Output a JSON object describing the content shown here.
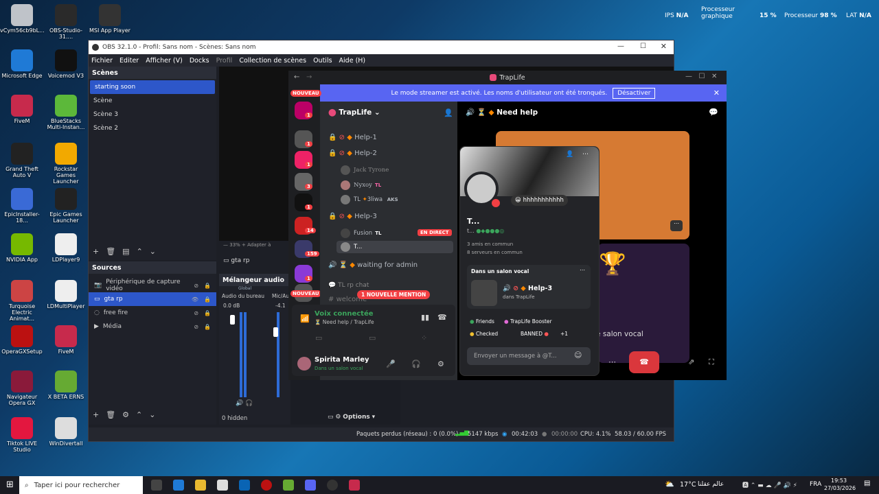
{
  "desktop": {
    "icons": [
      {
        "label": "vCym56cb9bL...",
        "color": "#bfc3c9"
      },
      {
        "label": "OBS-Studio-31....",
        "color": "#2a2a2a"
      },
      {
        "label": "MSI App Player",
        "color": "#333"
      },
      {
        "label": "Microsoft Edge",
        "color": "#1f7ad6"
      },
      {
        "label": "Voicemod V3",
        "color": "#111"
      },
      {
        "label": "FiveM",
        "color": "#c72a4c"
      },
      {
        "label": "BlueStacks Multi-Instan...",
        "color": "#5cb83a"
      },
      {
        "label": "Grand Theft Auto V",
        "color": "#222"
      },
      {
        "label": "Rockstar Games Launcher",
        "color": "#f2a900"
      },
      {
        "label": "EpicInstaller-18...",
        "color": "#3a6ad6"
      },
      {
        "label": "Epic Games Launcher",
        "color": "#222"
      },
      {
        "label": "NVIDIA App",
        "color": "#76b900"
      },
      {
        "label": "LDPlayer9",
        "color": "#eee"
      },
      {
        "label": "Turquoise Electric Animat...",
        "color": "#c44"
      },
      {
        "label": "LDMultiPlayer",
        "color": "#eee"
      },
      {
        "label": "OperaGXSetup",
        "color": "#b11"
      },
      {
        "label": "FiveM",
        "color": "#c72a4c"
      },
      {
        "label": "Navigateur Opera GX",
        "color": "#8a1a3a"
      },
      {
        "label": "X BETA ERNS",
        "color": "#6a3"
      },
      {
        "label": "Tiktok LIVE Studio",
        "color": "#e3173f"
      },
      {
        "label": "WinDivertall",
        "color": "#ddd"
      }
    ]
  },
  "overlay": {
    "ips_label": "IPS",
    "ips_value": "N/A",
    "gpu_label": "Processeur graphique",
    "gpu_value": "15 %",
    "cpu_label": "Processeur",
    "cpu_value": "98 %",
    "lat_label": "LAT",
    "lat_value": "N/A"
  },
  "obs": {
    "title": "OBS 32.1.0 - Profil: Sans nom - Scènes: Sans nom",
    "menu": [
      "Fichier",
      "Editer",
      "Afficher (V)",
      "Docks",
      "Profil",
      "Collection de scènes",
      "Outils",
      "Aide (H)"
    ],
    "scenes_header": "Scènes",
    "scenes": [
      "starting soon",
      "Scène",
      "Scène 3",
      "Scène 2"
    ],
    "sources_header": "Sources",
    "sources": [
      "Périphérique de capture vidéo",
      "gta rp",
      "free fire",
      "Média"
    ],
    "preview_label": "gta rp",
    "zoom": "33%",
    "fit": "Adapter à",
    "mixer_header": "Mélangeur audio",
    "mixer_global": "Global",
    "mixer_ch1": "Audio du bureau",
    "mixer_ch2": "Mic/Au",
    "mixer_db1": "0.0 dB",
    "mixer_db2": "-4.1",
    "hidden": "0 hidden",
    "options": "Options",
    "status": {
      "lost": "Paquets perdus (réseau) : 0 (0.0%)",
      "kbps": "5147 kbps",
      "rec": "00:42:03",
      "stream": "00:00:00",
      "cpu": "CPU: 4.1%",
      "fps": "58.03 / 60.00 FPS"
    }
  },
  "discord": {
    "title": "TrapLife",
    "banner": "Le mode streamer est activé. Les noms d'utilisateur ont été tronqués.",
    "banner_btn": "Désactiver",
    "new": "NOUVEAU",
    "server_name": "TrapLife",
    "channels": {
      "help1": "Help-1",
      "help2": "Help-2",
      "help3": "Help-3",
      "waiting": "waiting for admin",
      "chat": "TL rp chat",
      "welcome": "welcome"
    },
    "users": {
      "u1": "Jack Tyrone",
      "u2": "Nyxoy",
      "u3": "TL",
      "u3b": "3liwa",
      "u3c": "AKS",
      "u4": "Fusion",
      "u5": "T..."
    },
    "live": "EN DIRECT",
    "mention": "1 NOUVELLE MENTION",
    "voice_connected": "Voix connectée",
    "voice_path": "Need help / TrapLife",
    "me_name": "Spirita Marley",
    "me_status": "Dans un salon vocal",
    "channel_title": "Need help",
    "salon_vocal": "salon vocal",
    "badges": [
      "1",
      "1",
      "1",
      "3",
      "1",
      "14",
      "159",
      "1"
    ],
    "popup": {
      "status": "hhhhhhhhhhh",
      "name": "T...",
      "sub": "t...",
      "mutual_friends": "3 amis en commun",
      "mutual_servers": "8 serveurs en commun",
      "in_voice": "Dans un salon vocal",
      "voice_chan": "Help-3",
      "voice_srv": "dans TrapLife",
      "roles": [
        "Friends",
        "TrapLife Booster",
        "Checked",
        "BANNED",
        "+1"
      ],
      "msg_placeholder": "Envoyer un message à @T..."
    }
  },
  "taskbar": {
    "search": "Taper ici pour rechercher",
    "weather": "17°C",
    "weather_city": "عالم عقلنا",
    "lang": "FRA",
    "time": "19:53",
    "date": "27/03/2026"
  }
}
